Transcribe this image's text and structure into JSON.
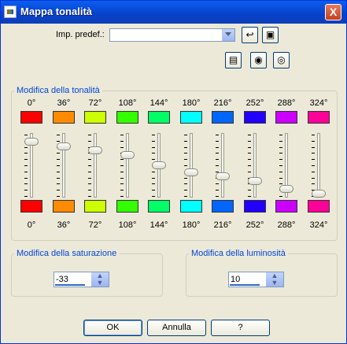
{
  "window": {
    "title": "Mappa tonalità",
    "close_glyph": "X"
  },
  "preset": {
    "label": "Imp. predef.:",
    "value": ""
  },
  "toolbar_icons": [
    "reset-icon",
    "save-icon",
    "randomize-icon",
    "eye-lock-icon",
    "eye-icon"
  ],
  "hue_group": {
    "title": "Modifica della tonalità"
  },
  "hue_bands": [
    {
      "degree": "0°",
      "color_top": "#ff0000",
      "color_bottom": "#ff0000",
      "level": 0.92
    },
    {
      "degree": "36°",
      "color_top": "#ff8c00",
      "color_bottom": "#ff8c00",
      "level": 0.84
    },
    {
      "degree": "72°",
      "color_top": "#ccff00",
      "color_bottom": "#ccff00",
      "level": 0.76
    },
    {
      "degree": "108°",
      "color_top": "#33ff00",
      "color_bottom": "#33ff00",
      "level": 0.68
    },
    {
      "degree": "144°",
      "color_top": "#00ff66",
      "color_bottom": "#00ff66",
      "level": 0.5
    },
    {
      "degree": "180°",
      "color_top": "#00ffff",
      "color_bottom": "#00ffff",
      "level": 0.37
    },
    {
      "degree": "216°",
      "color_top": "#0066ff",
      "color_bottom": "#0066ff",
      "level": 0.3
    },
    {
      "degree": "252°",
      "color_top": "#2200ff",
      "color_bottom": "#2200ff",
      "level": 0.22
    },
    {
      "degree": "288°",
      "color_top": "#cc00ff",
      "color_bottom": "#cc00ff",
      "level": 0.09
    },
    {
      "degree": "324°",
      "color_top": "#ff0099",
      "color_bottom": "#ff0099",
      "level": 0.0
    }
  ],
  "saturation": {
    "title": "Modifica della saturazione",
    "value": "-33"
  },
  "luminosity": {
    "title": "Modifica della luminosità",
    "value": "10"
  },
  "buttons": {
    "ok": "OK",
    "cancel": "Annulla",
    "help": "?"
  }
}
